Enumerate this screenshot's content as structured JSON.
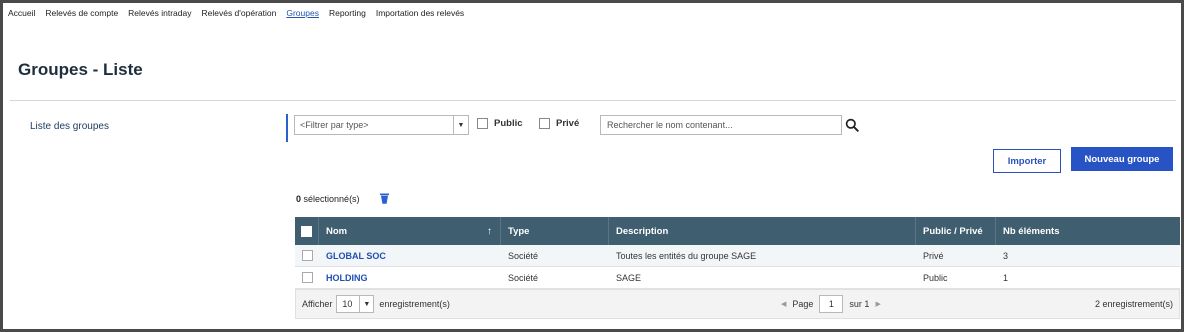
{
  "topnav": {
    "items": [
      {
        "label": "Accueil",
        "active": false
      },
      {
        "label": "Relevés de compte",
        "active": false
      },
      {
        "label": "Relevés intraday",
        "active": false
      },
      {
        "label": "Relevés d'opération",
        "active": false
      },
      {
        "label": "Groupes",
        "active": true
      },
      {
        "label": "Reporting",
        "active": false
      },
      {
        "label": "Importation des relevés",
        "active": false
      }
    ]
  },
  "page": {
    "title": "Groupes - Liste"
  },
  "sidebar": {
    "items": [
      {
        "label": "Liste des groupes"
      }
    ]
  },
  "filters": {
    "type_select": "<Filtrer par type>",
    "public_label": "Public",
    "prive_label": "Privé",
    "search_placeholder": "Rechercher le nom contenant..."
  },
  "actions": {
    "import_label": "Importer",
    "new_group_label": "Nouveau groupe"
  },
  "selection": {
    "count": "0",
    "suffix": "sélectionné(s)"
  },
  "table": {
    "headers": {
      "nom": "Nom",
      "type": "Type",
      "description": "Description",
      "public_prive": "Public / Privé",
      "nb_elements": "Nb éléments"
    },
    "rows": [
      {
        "nom": "GLOBAL SOC",
        "type": "Société",
        "description": "Toutes les entités du groupe SAGE",
        "public_prive": "Privé",
        "nb_elements": "3"
      },
      {
        "nom": "HOLDING",
        "type": "Société",
        "description": "SAGE",
        "public_prive": "Public",
        "nb_elements": "1"
      }
    ],
    "footer": {
      "show_label": "Afficher",
      "page_size": "10",
      "records_label": "enregistrement(s)",
      "page_label": "Page",
      "current_page": "1",
      "of_label": "sur 1",
      "total_records": "2 enregistrement(s)"
    }
  },
  "colors": {
    "accent": "#2853c4",
    "header_bg": "#3f5e70",
    "link": "#1f4fb0"
  },
  "icons": {
    "search": "search-icon",
    "delete": "trash-icon",
    "sort": "arrow-up-icon"
  }
}
